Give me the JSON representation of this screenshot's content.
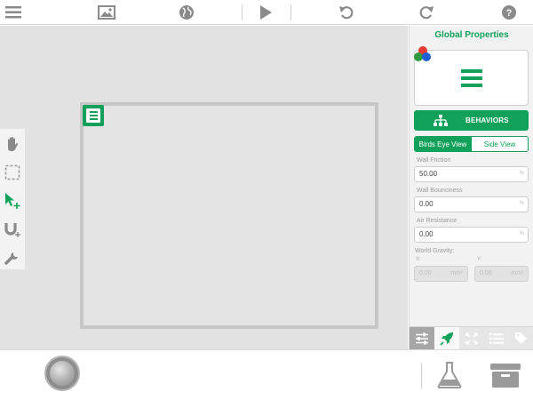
{
  "toolbar": {
    "icons": [
      "menu-icon",
      "image-icon",
      "globe-icon",
      "play-icon",
      "undo-icon",
      "redo-icon",
      "help-icon"
    ]
  },
  "left_tools": [
    "hand-icon",
    "marquee-select-icon",
    "move-select-icon",
    "magnet-icon",
    "wrench-icon"
  ],
  "panel": {
    "title": "Global Properties",
    "behaviors_label": "BEHAVIORS",
    "view_tabs": [
      "Birds Eye View",
      "Side View"
    ],
    "active_view": "Birds Eye View",
    "wall_friction": {
      "label": "Wall Friction",
      "value": "50.00",
      "unit": "%"
    },
    "wall_bounciness": {
      "label": "Wall Bounciness",
      "value": "0.00",
      "unit": "%"
    },
    "air_resistance": {
      "label": "Air Resistance",
      "value": "0.00",
      "unit": "%"
    },
    "world_gravity": {
      "label": "World Gravity:",
      "x_label": "X:",
      "y_label": "Y:",
      "x_value": "0.00",
      "y_value": "0.00",
      "unit": "m/s²"
    },
    "tabs": [
      "sliders-icon",
      "rocket-icon",
      "expand-icon",
      "list-icon",
      "tags-icon"
    ],
    "active_tab": "rocket-icon"
  },
  "bottom": {
    "icons": [
      "play-circle-button",
      "flask-icon",
      "drawer-icon"
    ]
  },
  "colors": {
    "accent": "#12a15a",
    "panel_bg": "#f2f2f2",
    "canvas_bg": "#e2e2e2"
  }
}
